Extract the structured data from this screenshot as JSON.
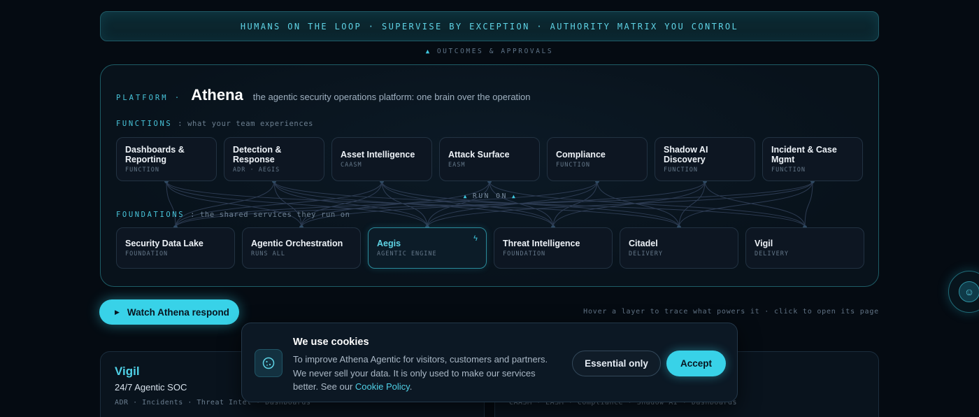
{
  "banner": {
    "text": "HUMANS ON THE LOOP · SUPERVISE BY EXCEPTION · AUTHORITY MATRIX YOU CONTROL"
  },
  "outcomes": {
    "text": "OUTCOMES & APPROVALS"
  },
  "platform": {
    "label": "PLATFORM ·",
    "name": "Athena",
    "description": "the agentic security operations platform: one brain over the operation",
    "functions_label": "FUNCTIONS",
    "functions_sub": ": what your team experiences",
    "foundations_label": "FOUNDATIONS",
    "foundations_sub": ": the shared services they run on",
    "run_on": "RUN ON",
    "functions": [
      {
        "title": "Dashboards & Reporting",
        "sub": "FUNCTION"
      },
      {
        "title": "Detection & Response",
        "sub": "ADR · AEGIS"
      },
      {
        "title": "Asset Intelligence",
        "sub": "CAASM"
      },
      {
        "title": "Attack Surface",
        "sub": "EASM"
      },
      {
        "title": "Compliance",
        "sub": "FUNCTION"
      },
      {
        "title": "Shadow AI Discovery",
        "sub": "FUNCTION"
      },
      {
        "title": "Incident & Case Mgmt",
        "sub": "FUNCTION"
      }
    ],
    "foundations": [
      {
        "title": "Security Data Lake",
        "sub": "FOUNDATION"
      },
      {
        "title": "Agentic Orchestration",
        "sub": "RUNS ALL"
      },
      {
        "title": "Aegis",
        "sub": "AGENTIC ENGINE"
      },
      {
        "title": "Threat Intelligence",
        "sub": "FOUNDATION"
      },
      {
        "title": "Citadel",
        "sub": "DELIVERY"
      },
      {
        "title": "Vigil",
        "sub": "DELIVERY"
      }
    ]
  },
  "cta": {
    "watch": "Watch Athena respond"
  },
  "hint": "Hover a layer to trace what powers it · click to open its page",
  "products": [
    {
      "name": "Vigil",
      "tagline": "24/7 Agentic SOC",
      "tags": "ADR · Incidents · Threat Intel · Dashboards"
    },
    {
      "tags": "CAASM · EASM · Compliance · Shadow AI · Dashboards"
    }
  ],
  "cookie": {
    "title": "We use cookies",
    "body": "To improve Athena Agentic for visitors, customers and partners. We never sell your data. It is only used to make our services better. See our ",
    "link": "Cookie Policy",
    "period": ".",
    "essential": "Essential only",
    "accept": "Accept"
  },
  "icons": {
    "play": "play-icon",
    "bolt": "bolt-icon",
    "cookie": "cookie-icon",
    "assistant": "assistant-icon"
  },
  "colors": {
    "accent": "#38d2e8",
    "background": "#050b12",
    "panel_border": "#1e5c66"
  }
}
